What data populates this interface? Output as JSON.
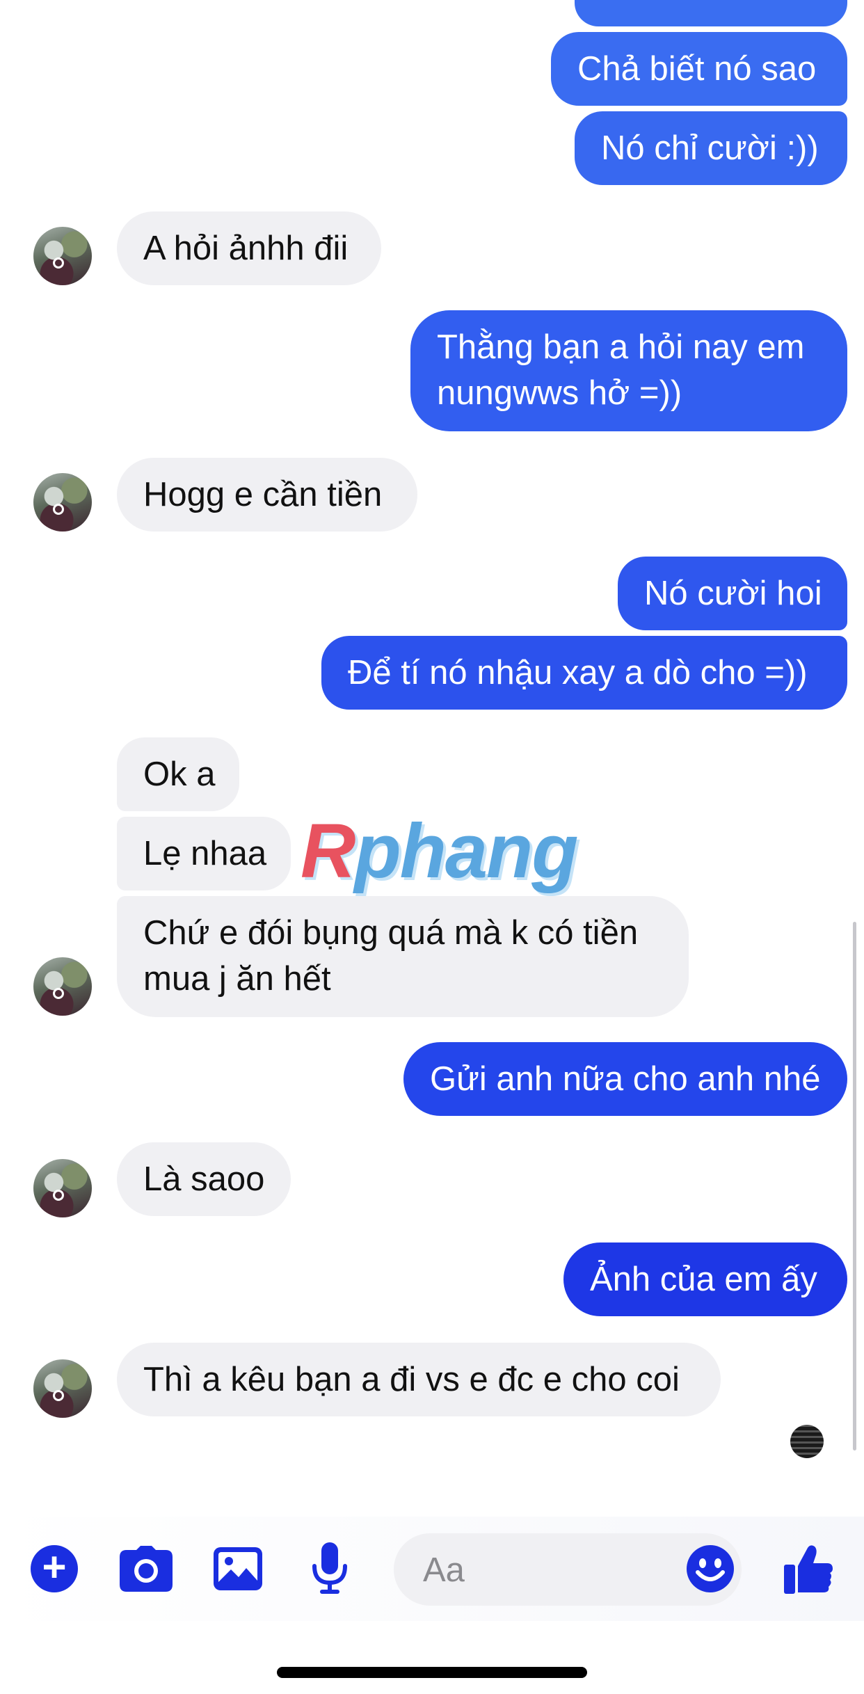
{
  "colors": {
    "outgoing_top": "#2f6bf0",
    "outgoing_bottom": "#1a2ee0",
    "incoming_bubble": "#f0f0f3",
    "accent": "#1a2ee0"
  },
  "watermark": {
    "first_letter": "R",
    "rest": "phang"
  },
  "messages": [
    {
      "side": "out",
      "text": "Chả biết nó sao"
    },
    {
      "side": "out",
      "text": "Nó chỉ cười :))"
    },
    {
      "side": "in",
      "text": "A hỏi ảnhh đii"
    },
    {
      "side": "out",
      "line1": "Thằng bạn a hỏi nay em",
      "line2": "nungwws hở =))"
    },
    {
      "side": "in",
      "text": "Hogg e cần tiền"
    },
    {
      "side": "out",
      "text": "Nó cười hoi"
    },
    {
      "side": "out",
      "text": "Để tí nó nhậu xay a dò cho =))"
    },
    {
      "side": "in",
      "text": "Ok a"
    },
    {
      "side": "in",
      "text": "Lẹ nhaa"
    },
    {
      "side": "in",
      "line1": "Chứ e đói bụng quá mà k có tiền",
      "line2": "mua j ăn hết"
    },
    {
      "side": "out",
      "text": "Gửi anh nữa cho anh nhé"
    },
    {
      "side": "in",
      "text": "Là saoo"
    },
    {
      "side": "out",
      "text": "Ảnh của em ấy"
    },
    {
      "side": "in",
      "text": "Thì a kêu bạn a đi vs e đc e cho coi"
    }
  ],
  "composer": {
    "placeholder": "Aa",
    "icons": [
      "plus-icon",
      "camera-icon",
      "image-icon",
      "microphone-icon",
      "emoji-icon",
      "thumbs-up-icon"
    ]
  }
}
